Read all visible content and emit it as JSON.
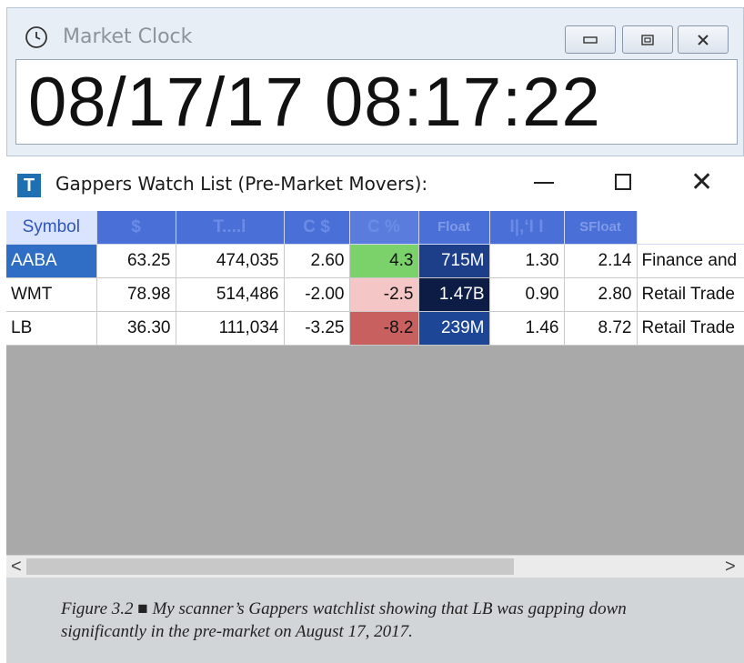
{
  "clock_window": {
    "title": "Market Clock",
    "time": "08/17/17 08:17:22",
    "buttons": {
      "minimize": "minimize-icon",
      "restore": "restore-icon",
      "close": "close-icon"
    }
  },
  "watch_window": {
    "logo": "T",
    "title": "Gappers Watch List (Pre-Market Movers):",
    "columns": [
      {
        "key": "symbol",
        "label": "Symbol"
      },
      {
        "key": "price",
        "label": "$"
      },
      {
        "key": "volume",
        "label": "T....l"
      },
      {
        "key": "chg",
        "label": "C $"
      },
      {
        "key": "chgpct",
        "label": "C %"
      },
      {
        "key": "float",
        "label": "Float"
      },
      {
        "key": "rel",
        "label": "I|,‘I I"
      },
      {
        "key": "sfloat",
        "label": "SFloat"
      },
      {
        "key": "sector",
        "label": ""
      }
    ],
    "rows": [
      {
        "symbol": "AABA",
        "price": "63.25",
        "volume": "474,035",
        "chg": "2.60",
        "chgpct": "4.3",
        "float": "715M",
        "rel": "1.30",
        "sfloat": "2.14",
        "sector": "Finance and"
      },
      {
        "symbol": "WMT",
        "price": "78.98",
        "volume": "514,486",
        "chg": "-2.00",
        "chgpct": "-2.5",
        "float": "1.47B",
        "rel": "0.90",
        "sfloat": "2.80",
        "sector": "Retail Trade"
      },
      {
        "symbol": "LB",
        "price": "36.30",
        "volume": "111,034",
        "chg": "-3.25",
        "chgpct": "-8.2",
        "float": "239M",
        "rel": "1.46",
        "sfloat": "8.72",
        "sector": "Retail Trade"
      }
    ],
    "float_colors": [
      "#1d3f8a",
      "#0c1c45",
      "#1e4696"
    ],
    "scroll": {
      "left": "<",
      "right": ">"
    }
  },
  "caption": {
    "text": "Figure 3.2 ■ My scanner’s Gappers watchlist showing that LB was gapping down significantly in the pre-market on August 17, 2017."
  }
}
